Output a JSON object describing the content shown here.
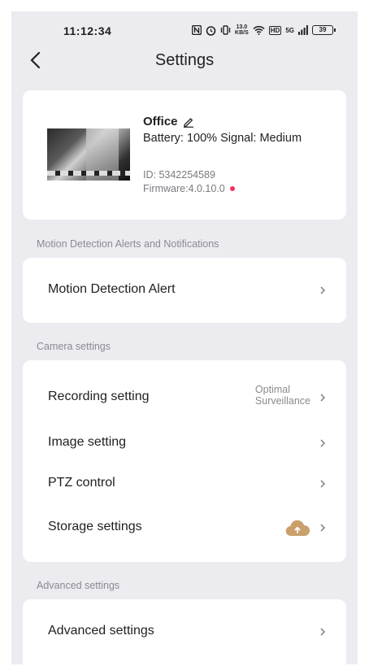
{
  "status_bar": {
    "time": "11:12:34",
    "speed_top": "13.0",
    "speed_bottom": "KB/S",
    "hd": "HD",
    "network": "5G",
    "battery": "39",
    "icons": [
      "nfc-icon",
      "alarm-icon",
      "vibrate-icon",
      "wifi-icon",
      "signal-icon"
    ]
  },
  "header": {
    "title": "Settings",
    "back_icon": "chevron-left-icon"
  },
  "device": {
    "name": "Office",
    "battery_signal": "Battery:  100% Signal:  Medium",
    "id": "ID:  5342254589",
    "firmware": "Firmware:4.0.10.0",
    "update_dot_color": "#f0325a"
  },
  "sections": {
    "motion_label": "Motion Detection Alerts and Notifications",
    "camera_label": "Camera settings",
    "advanced_label": "Advanced settings"
  },
  "rows": {
    "motion_alert": "Motion Detection Alert",
    "recording": "Recording setting",
    "recording_value_1": "Optimal",
    "recording_value_2": "Surveillance",
    "image": "Image setting",
    "ptz": "PTZ control",
    "storage": "Storage settings",
    "advanced": "Advanced settings"
  },
  "colors": {
    "background": "#ecebf0",
    "card": "#ffffff",
    "cloud": "#c9a06a",
    "muted": "#8a8a90"
  }
}
